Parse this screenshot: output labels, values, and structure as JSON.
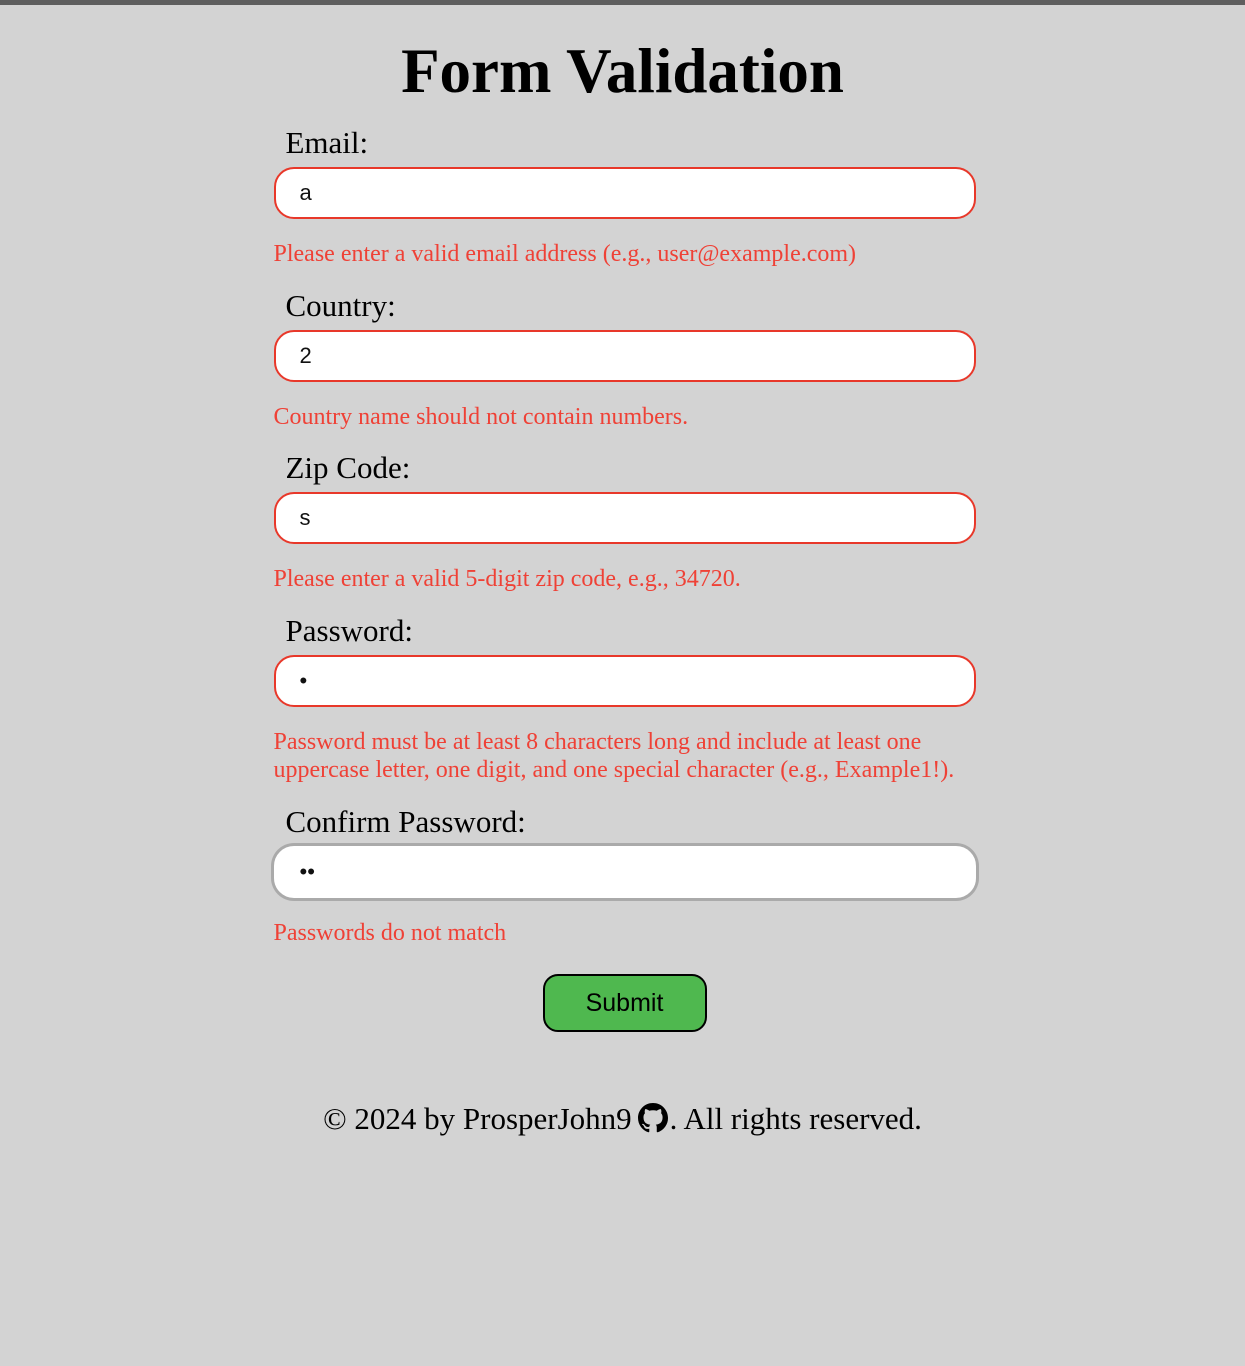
{
  "page": {
    "title": "Form Validation",
    "background_color": "#d3d3d3",
    "top_strip_color": "#5e5e5e"
  },
  "form": {
    "fields": [
      {
        "name": "email",
        "label": "Email:",
        "value": "a",
        "placeholder": "",
        "error": "Please enter a valid email address (e.g., user@example.com)",
        "state": "invalid",
        "border_color": "#e8382a"
      },
      {
        "name": "country",
        "label": "Country:",
        "value": "2",
        "placeholder": "",
        "error": "Country name should not contain numbers.",
        "state": "invalid",
        "border_color": "#e8382a"
      },
      {
        "name": "zip",
        "label": "Zip Code:",
        "value": "s",
        "placeholder": "",
        "error": "Please enter a valid 5-digit zip code, e.g., 34720.",
        "state": "invalid",
        "border_color": "#e8382a"
      },
      {
        "name": "password",
        "label": "Password:",
        "value": "•",
        "placeholder": "",
        "error": "Password must be at least 8 characters long and include at least one uppercase letter, one digit, and one special character (e.g., Example1!).",
        "state": "invalid",
        "border_color": "#e8382a"
      },
      {
        "name": "confirm-password",
        "label": "Confirm Password:",
        "value": "••",
        "placeholder": "",
        "error": "Passwords do not match",
        "state": "focused",
        "border_color": "#aaaaaa"
      }
    ],
    "submit_label": "Submit",
    "submit_color": "#4fb84f",
    "error_color": "#ef4136"
  },
  "footer": {
    "text_before": "© 2024 by ProsperJohn9",
    "icon": "github-icon",
    "text_after": ". All rights reserved."
  }
}
